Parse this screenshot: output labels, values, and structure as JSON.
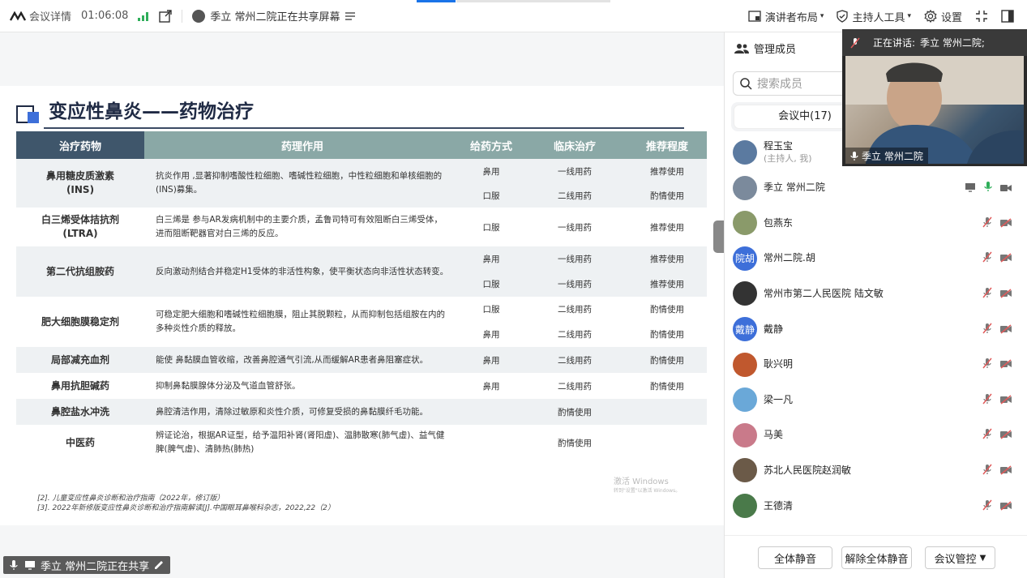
{
  "topbar": {
    "meeting_info": "会议详情",
    "time": "01:06:08",
    "sharer": "季立 常州二院正在共享屏幕",
    "layout": "演讲者布局",
    "host_tools": "主持人工具",
    "settings": "设置"
  },
  "slide": {
    "title": "变应性鼻炎——药物治疗",
    "headers": [
      "治疗药物",
      "药理作用",
      "给药方式",
      "临床治疗",
      "推荐程度"
    ],
    "rows": [
      {
        "name": "鼻用糖皮质激素\n(INS)",
        "mech": "抗炎作用 ,显著抑制嗜酸性粒细胞、嗜碱性粒细胞，中性粒细胞和单核细胞的(INS)募集。",
        "sub": [
          [
            "鼻用",
            "一线用药",
            "推荐使用"
          ],
          [
            "口服",
            "二线用药",
            "酌情使用"
          ]
        ]
      },
      {
        "name": "白三烯受体拮抗剂\n(LTRA)",
        "mech": "白三烯是 参与AR发病机制中的主要介质，孟鲁司特可有效阻断白三烯受体，进而阻断靶器官对白三烯的反应。",
        "sub": [
          [
            "口服",
            "一线用药",
            "推荐使用"
          ]
        ]
      },
      {
        "name": "第二代抗组胺药",
        "mech": "反向激动剂结合并稳定H1受体的非活性构象，使平衡状态向非活性状态转变。",
        "sub": [
          [
            "鼻用",
            "一线用药",
            "推荐使用"
          ],
          [
            "口服",
            "一线用药",
            "推荐使用"
          ]
        ]
      },
      {
        "name": "肥大细胞膜稳定剂",
        "mech": "可稳定肥大细胞和嗜碱性粒细胞膜，阻止其脱颗粒，从而抑制包括组胺在内的多种炎性介质的释放。",
        "sub": [
          [
            "口服",
            "二线用药",
            "酌情使用"
          ],
          [
            "鼻用",
            "二线用药",
            "酌情使用"
          ]
        ]
      },
      {
        "name": "局部减充血剂",
        "mech": "能使 鼻黏膜血管收缩，改善鼻腔通气引流,从而缓解AR患者鼻阻塞症状。",
        "sub": [
          [
            "鼻用",
            "二线用药",
            "酌情使用"
          ]
        ]
      },
      {
        "name": "鼻用抗胆碱药",
        "mech": "抑制鼻黏膜腺体分泌及气道血管舒张。",
        "sub": [
          [
            "鼻用",
            "二线用药",
            "酌情使用"
          ]
        ]
      },
      {
        "name": "鼻腔盐水冲洗",
        "mech": "鼻腔清洁作用，清除过敏原和炎性介质，可修复受损的鼻黏膜纤毛功能。",
        "sub": [
          [
            "",
            "酌情使用",
            ""
          ]
        ]
      },
      {
        "name": "中医药",
        "mech": "辨证论治，根据AR证型，给予温阳补肾(肾阳虚)、温肺散寒(肺气虚)、益气健脾(脾气虚)、清肺热(肺热)",
        "sub": [
          [
            "",
            "酌情使用",
            ""
          ]
        ]
      }
    ],
    "refs": [
      "[2]. 儿童变应性鼻炎诊断和治疗指南（2022年，修订版）",
      "[3]. 2022年新修版变应性鼻炎诊断和治疗指南解读[J].中国眼耳鼻喉科杂志，2022,22（2）"
    ],
    "watermark": "激活 Windows",
    "watermark_sub": "转到\"设置\"以激活 Windows。"
  },
  "share_bar": "季立 常州二院正在共享",
  "panel": {
    "title": "管理成员",
    "search_placeholder": "搜索成员",
    "tab": "会议中(17)",
    "members": [
      {
        "name": "程玉宝",
        "sub": "(主持人, 我)",
        "avatar": "",
        "color": "#5b7aa0"
      },
      {
        "name": "季立 常州二院",
        "sub": "",
        "avatar": "",
        "color": "#7b8a9c"
      },
      {
        "name": "包燕东",
        "sub": "",
        "avatar": "",
        "color": "#8a9a6a"
      },
      {
        "name": "常州二院.胡",
        "sub": "",
        "avatar": "院胡",
        "color": "#3d6fd9"
      },
      {
        "name": "常州市第二人民医院 陆文敏",
        "sub": "",
        "avatar": "",
        "color": "#333"
      },
      {
        "name": "戴静",
        "sub": "",
        "avatar": "戴静",
        "color": "#3d6fd9"
      },
      {
        "name": "耿兴明",
        "sub": "",
        "avatar": "",
        "color": "#c0582e"
      },
      {
        "name": "梁一凡",
        "sub": "",
        "avatar": "",
        "color": "#6aa8d8"
      },
      {
        "name": "马美",
        "sub": "",
        "avatar": "",
        "color": "#c97a8a"
      },
      {
        "name": "苏北人民医院赵润敏",
        "sub": "",
        "avatar": "",
        "color": "#6b5a48"
      },
      {
        "name": "王德清",
        "sub": "",
        "avatar": "",
        "color": "#4a7a4a"
      }
    ],
    "buttons": [
      "全体静音",
      "解除全体静音",
      "会议管控"
    ]
  },
  "video": {
    "speaking_label": "正在讲话:",
    "speaker": "季立 常州二院;",
    "name": "季立 常州二院"
  },
  "colors": {
    "header_dark": "#3f566b",
    "header_teal": "#8aa8a6",
    "accent_blue": "#1a73e8",
    "muted_red": "#e05a5a",
    "mic_green": "#2fae5a"
  }
}
